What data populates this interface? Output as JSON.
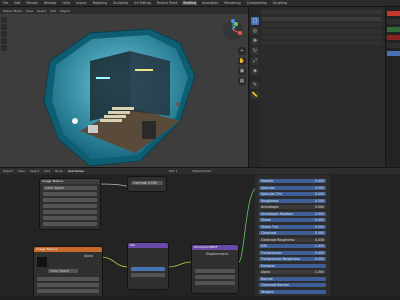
{
  "topbar": {
    "menus": [
      "File",
      "Edit",
      "Render",
      "Window",
      "Help",
      "Layout",
      "Modeling",
      "Sculpting",
      "UV Editing",
      "Texture Paint",
      "Shading",
      "Animation",
      "Rendering",
      "Compositing",
      "Scripting"
    ],
    "active_index": 10
  },
  "viewport": {
    "header_items": [
      "Object Mode",
      "View",
      "Select",
      "Add",
      "Object"
    ],
    "gizmo_axes": [
      "X",
      "Y",
      "Z"
    ]
  },
  "node_editor": {
    "header_items": [
      "Object",
      "View",
      "Select",
      "Add",
      "Node",
      "Use Nodes"
    ],
    "slot_label": "Slot 1",
    "material_label": "Material.001",
    "nodes": [
      {
        "title": "Image Texture",
        "label": "Color Space",
        "extra_label": "Alpha"
      },
      {
        "title": "Image Texture",
        "label": "Color Space"
      },
      {
        "title": "Mix"
      },
      {
        "title": "Principled BSDF",
        "label": "Displacement"
      }
    ],
    "value_label": "Contrast",
    "value": "0.000"
  },
  "side_panel": {
    "rows": [
      {
        "label": "Metallic",
        "value": "0.000"
      },
      {
        "label": "Specular",
        "value": "0.500"
      },
      {
        "label": "Specular Tint",
        "value": "0.000"
      },
      {
        "label": "Roughness",
        "value": "0.500"
      },
      {
        "label": "Anisotropic",
        "value": "0.000"
      },
      {
        "label": "Anisotropic Rotation",
        "value": "0.000"
      },
      {
        "label": "Sheen",
        "value": "0.000"
      },
      {
        "label": "Sheen Tint",
        "value": "0.500"
      },
      {
        "label": "Clearcoat",
        "value": "0.000"
      },
      {
        "label": "Clearcoat Roughness",
        "value": "0.030"
      },
      {
        "label": "IOR",
        "value": "1.450"
      },
      {
        "label": "Transmission",
        "value": "0.000"
      },
      {
        "label": "Transmission Roughness",
        "value": "0.000"
      },
      {
        "label": "Emission",
        "value": ""
      },
      {
        "label": "Alpha",
        "value": "1.000"
      },
      {
        "label": "Normal",
        "value": ""
      },
      {
        "label": "Clearcoat Normal",
        "value": ""
      },
      {
        "label": "Tangent",
        "value": ""
      }
    ]
  },
  "colors": {
    "accent": "#4772b3",
    "viewport_bg": "#3d3d3d",
    "node_orange": "#c96a2a",
    "node_purple": "#6a4aa8"
  }
}
